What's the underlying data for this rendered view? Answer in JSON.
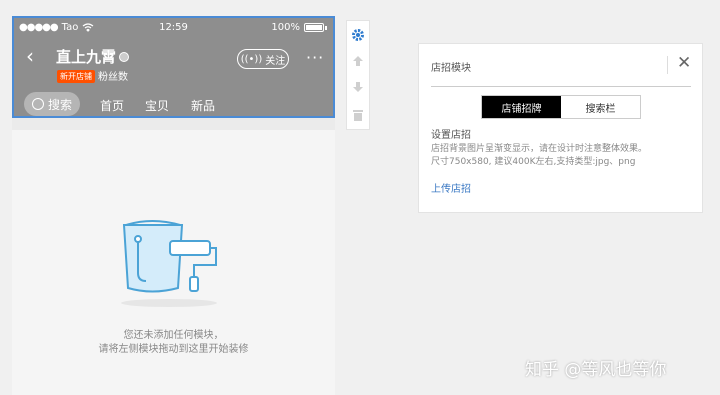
{
  "statusbar": {
    "carrier": "Tao",
    "time": "12:59",
    "battery": "100%"
  },
  "shop": {
    "back_icon": "chevron-left-icon",
    "name": "直上九霄",
    "badge": "新开店铺",
    "fans_label": "粉丝数",
    "follow_label": "关注",
    "more_label": "···"
  },
  "nav": {
    "search_label": "搜索",
    "items": [
      "首页",
      "宝贝",
      "新品"
    ]
  },
  "empty": {
    "line1": "您还未添加任何模块，",
    "line2": "请将左侧模块拖动到这里开始装修"
  },
  "toolbar": {
    "icons": [
      "gear-icon",
      "arrow-up-icon",
      "arrow-down-icon",
      "trash-icon"
    ]
  },
  "panel": {
    "title": "店招模块",
    "close_label": "✕",
    "tabs": [
      "店铺招牌",
      "搜索栏"
    ],
    "active_tab": 0,
    "setting_title": "设置店招",
    "desc_line1": "店招背景图片呈渐变显示，请在设计时注意整体效果。",
    "desc_line2": "尺寸750x580, 建议400K左右,支持类型:jpg、png",
    "upload_label": "上传店招"
  },
  "watermark": "知乎 @等风也等你",
  "colors": {
    "accent": "#4a8bd6",
    "badge": "#ff5000",
    "link": "#3a78c3"
  }
}
